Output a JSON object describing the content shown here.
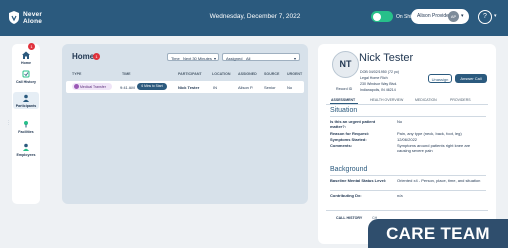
{
  "app": {
    "logo_line1": "Never",
    "logo_line2": "Alone",
    "date": "Wednesday, December 7, 2022",
    "shift_status": "On Shift",
    "provider_label": "Alison Provider",
    "provider_initials": "AP",
    "help_icon": "question-icon"
  },
  "sidebar": {
    "badge": "1",
    "items": [
      {
        "label": "Home",
        "icon": "home-icon"
      },
      {
        "label": "Call History",
        "icon": "call-history-icon"
      },
      {
        "label": "Participants",
        "icon": "participants-icon"
      },
      {
        "label": "Facilities",
        "icon": "facilities-icon"
      },
      {
        "label": "Employees",
        "icon": "employees-icon"
      }
    ]
  },
  "home": {
    "title": "Home",
    "badge": "1",
    "filters": {
      "time_label": "Time",
      "time_value": "Next 30 Minutes",
      "assigned_label": "Assigned",
      "assigned_value": "All"
    },
    "columns": [
      "TYPE",
      "TIME",
      "PARTICIPANT",
      "LOCATION",
      "ASSIGNED",
      "SOURCE",
      "URGENT"
    ],
    "rows": [
      {
        "type": "Medical Transfer",
        "time": "9:41 AM",
        "time_tag": "6 Mins to Start",
        "participant": "Nick Tester",
        "location": "IN",
        "assigned": "Alison P.",
        "source": "Senior",
        "urgent": "No"
      }
    ]
  },
  "patient": {
    "initials": "NT",
    "name": "Nick Tester",
    "record_label": "Record ID",
    "dob": "DOB 04/02/1950 (72 yo)",
    "facility": "Legal Home Rich",
    "address1": "230 Windsor Way Blvd.",
    "address2": "Indianapolis, IN 46214",
    "unassign": "Unassign",
    "answer": "Answer Call",
    "tabs": [
      "ASSESSMENT",
      "HEALTH OVERVIEW",
      "MEDICATION",
      "PROVIDERS"
    ],
    "situation": {
      "heading": "Situation",
      "fields": [
        {
          "q": "Is this an urgent patient matter?:",
          "a": "No"
        },
        {
          "q": "Reason for Request:",
          "a": "Pain, any type (neck, back, foot, leg)"
        },
        {
          "q": "Symptoms Started:",
          "a": "12/06/2022"
        },
        {
          "q": "Comments:",
          "a": "Symptoms around patients right knee are causing severe pain"
        }
      ]
    },
    "background": {
      "heading": "Background",
      "fields": [
        {
          "q": "Baseline Mental Status Level:",
          "a": "Oriented x4 - Person, place, time, and situation"
        },
        {
          "q": "Contributing Dx:",
          "a": "n/a"
        }
      ]
    },
    "footer_tabs": [
      "CALL HISTORY",
      "CH"
    ]
  },
  "ribbon": "CARE TEAM",
  "colors": {
    "topbar": "#2b5a7e",
    "ribbon": "#2f4e6d",
    "badge": "#e0323c",
    "toggle": "#27c08a"
  }
}
